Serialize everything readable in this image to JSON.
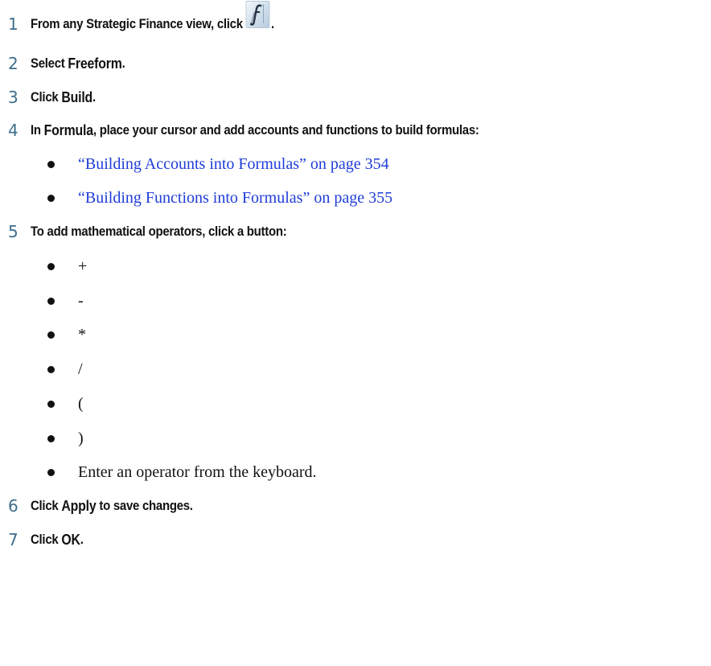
{
  "steps": [
    {
      "number": "1",
      "text_before": "From any Strategic Finance view, click",
      "icon": "formula-function-icon",
      "text_after": "."
    },
    {
      "number": "2",
      "text_before": "Select ",
      "bold": "Freeform",
      "text_after": "."
    },
    {
      "number": "3",
      "text_before": "Click ",
      "bold": "Build",
      "text_after": "."
    },
    {
      "number": "4",
      "text_before": "In ",
      "bold": "Formula",
      "text_after": ", place your cursor and add accounts and functions to build formulas:"
    },
    {
      "number": "5",
      "text_before": "To add mathematical operators, click a button:"
    },
    {
      "number": "6",
      "text_before": "Click ",
      "bold": "Apply",
      "text_after": " to save changes."
    },
    {
      "number": "7",
      "text_before": "Click ",
      "bold": "OK",
      "text_after": "."
    }
  ],
  "step4_links": [
    "“Building Accounts into Formulas” on page 354",
    "“Building Functions into Formulas” on page 355"
  ],
  "step5_operators": [
    "+",
    "-",
    "*",
    "/",
    "(",
    ")",
    "Enter an operator from the keyboard."
  ],
  "colors": {
    "step_number": "#3e6f8c",
    "link": "#1f3dd8",
    "text": "#111111"
  }
}
